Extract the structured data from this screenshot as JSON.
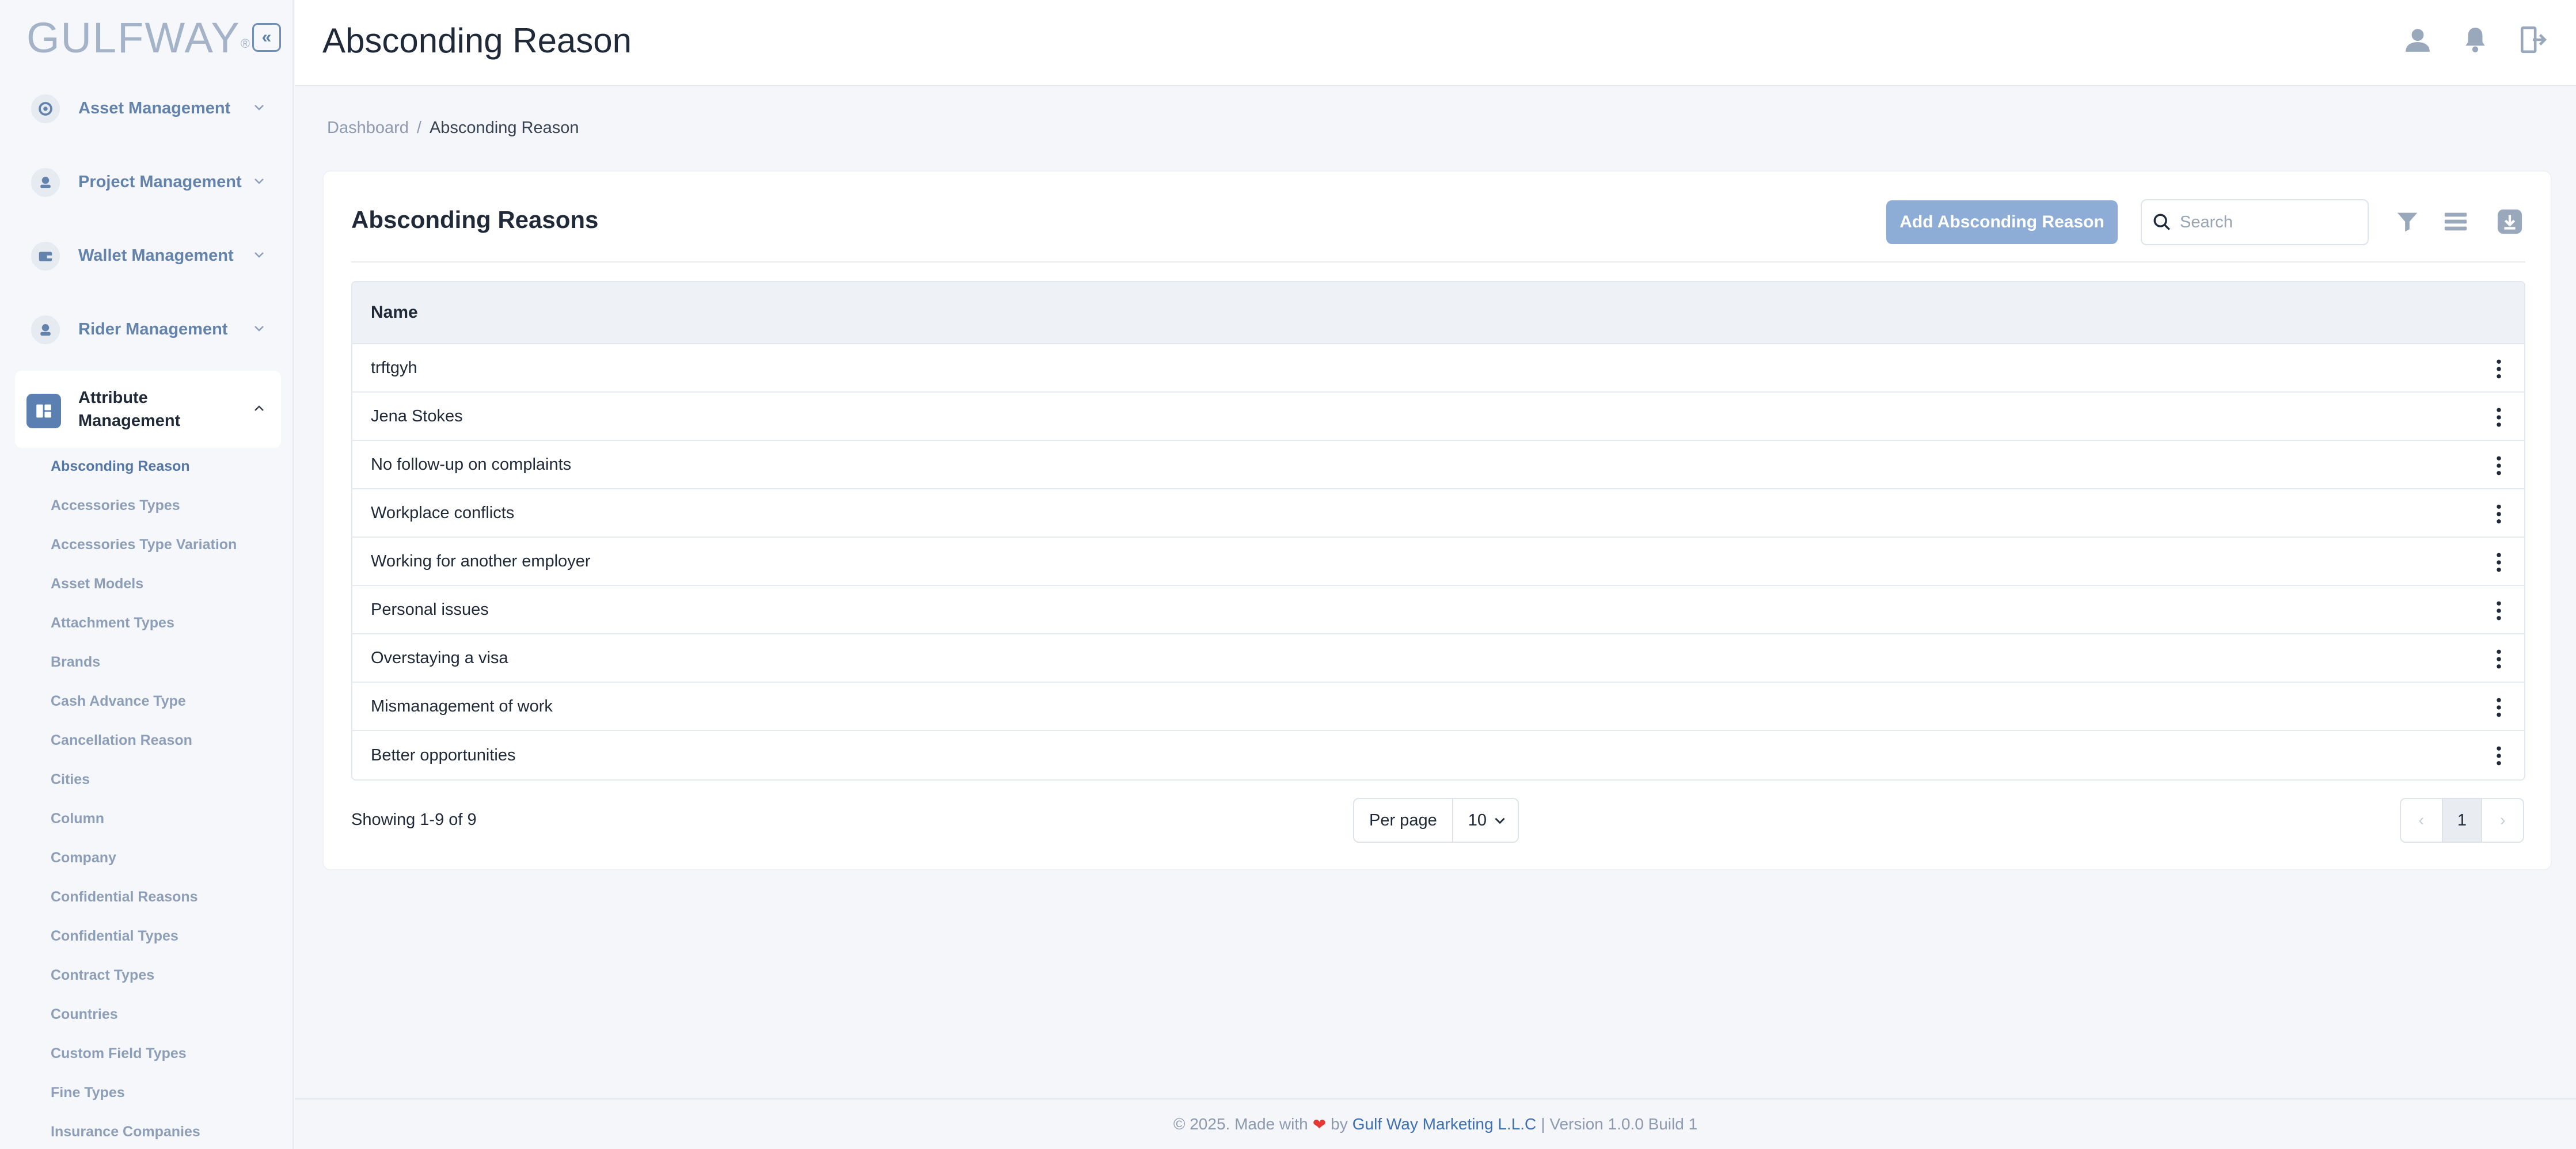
{
  "brand": {
    "name": "GULFWAY",
    "reg_mark": "®"
  },
  "sidebar": {
    "collapse_label": "«",
    "groups": [
      {
        "label": "Asset Management",
        "icon": "asset-icon"
      },
      {
        "label": "Project Management",
        "icon": "project-icon"
      },
      {
        "label": "Wallet Management",
        "icon": "wallet-icon"
      },
      {
        "label": "Rider Management",
        "icon": "rider-icon"
      },
      {
        "label": "Attribute Management",
        "icon": "attribute-icon"
      }
    ],
    "sub_items": [
      "Absconding Reason",
      "Accessories Types",
      "Accessories Type Variation",
      "Asset Models",
      "Attachment Types",
      "Brands",
      "Cash Advance Type",
      "Cancellation Reason",
      "Cities",
      "Column",
      "Company",
      "Confidential Reasons",
      "Confidential Types",
      "Contract Types",
      "Countries",
      "Custom Field Types",
      "Fine Types",
      "Insurance Companies"
    ]
  },
  "header": {
    "title": "Absconding Reason"
  },
  "breadcrumb": {
    "home": "Dashboard",
    "separator": "/",
    "current": "Absconding Reason"
  },
  "card": {
    "title": "Absconding Reasons",
    "add_button": "Add Absconding Reason",
    "search_placeholder": "Search",
    "table": {
      "column": "Name",
      "rows": [
        "trftgyh",
        "Jena Stokes",
        "No follow-up on complaints",
        "Workplace conflicts",
        "Working for another employer",
        "Personal issues",
        "Overstaying a visa",
        "Mismanagement of work",
        "Better opportunities"
      ]
    },
    "showing": "Showing 1-9 of 9",
    "per_page_label": "Per page",
    "per_page_value": "10",
    "pagination": {
      "prev": "‹",
      "current": "1",
      "next": "›"
    }
  },
  "footer": {
    "prefix": "© 2025. Made with",
    "heart": "❤",
    "by": "by",
    "company": "Gulf Way Marketing L.L.C",
    "version": "| Version 1.0.0 Build 1"
  },
  "colors": {
    "accent": "#5b7fb0",
    "button": "#8eadd6",
    "link": "#3f6fb3"
  }
}
